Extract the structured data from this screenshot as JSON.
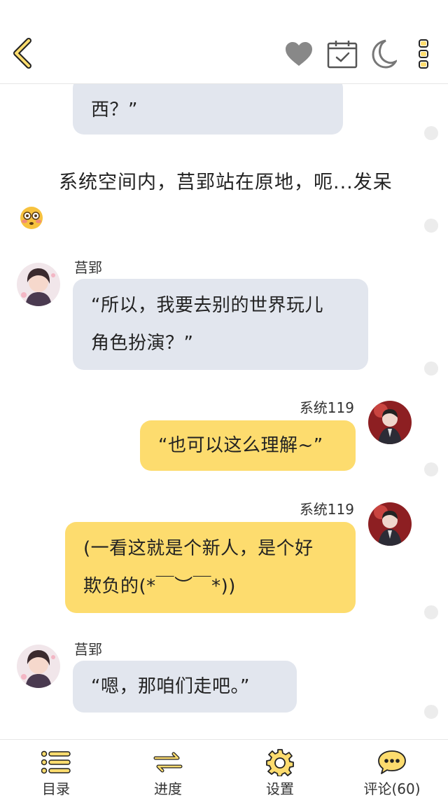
{
  "header": {
    "icons": [
      "back-chevron-icon",
      "heart-icon",
      "calendar-check-icon",
      "moon-icon",
      "more-vertical-icon"
    ]
  },
  "colors": {
    "accent": "#e6b53a",
    "gray_bubble": "#e2e6ee",
    "yellow_bubble": "#fddc6e",
    "icon_gray": "#999999"
  },
  "messages": [
    {
      "type": "bubble",
      "side": "left",
      "text": "西？”"
    },
    {
      "type": "narration",
      "text": "系统空间内，莒郢站在原地，呃...发呆",
      "emoji": "flushed-face-icon"
    },
    {
      "type": "bubble",
      "side": "left",
      "speaker": "莒郢",
      "line1": "“所以，我要去别的世界玩儿",
      "line2": "角色扮演？”"
    },
    {
      "type": "bubble",
      "side": "right",
      "speaker": "系统119",
      "text": "“也可以这么理解~”"
    },
    {
      "type": "bubble",
      "side": "right",
      "speaker": "系统119",
      "line1": "(一看这就是个新人，是个好",
      "line2": "欺负的(*￣︶￣*))"
    },
    {
      "type": "bubble",
      "side": "left",
      "speaker": "莒郢",
      "text": "“嗯，那咱们走吧。”"
    }
  ],
  "bottom_nav": [
    {
      "label": "目录",
      "icon": "list-icon"
    },
    {
      "label": "进度",
      "icon": "swap-arrows-icon"
    },
    {
      "label": "设置",
      "icon": "gear-icon"
    },
    {
      "label": "评论(60)",
      "icon": "comment-bubble-icon"
    }
  ]
}
